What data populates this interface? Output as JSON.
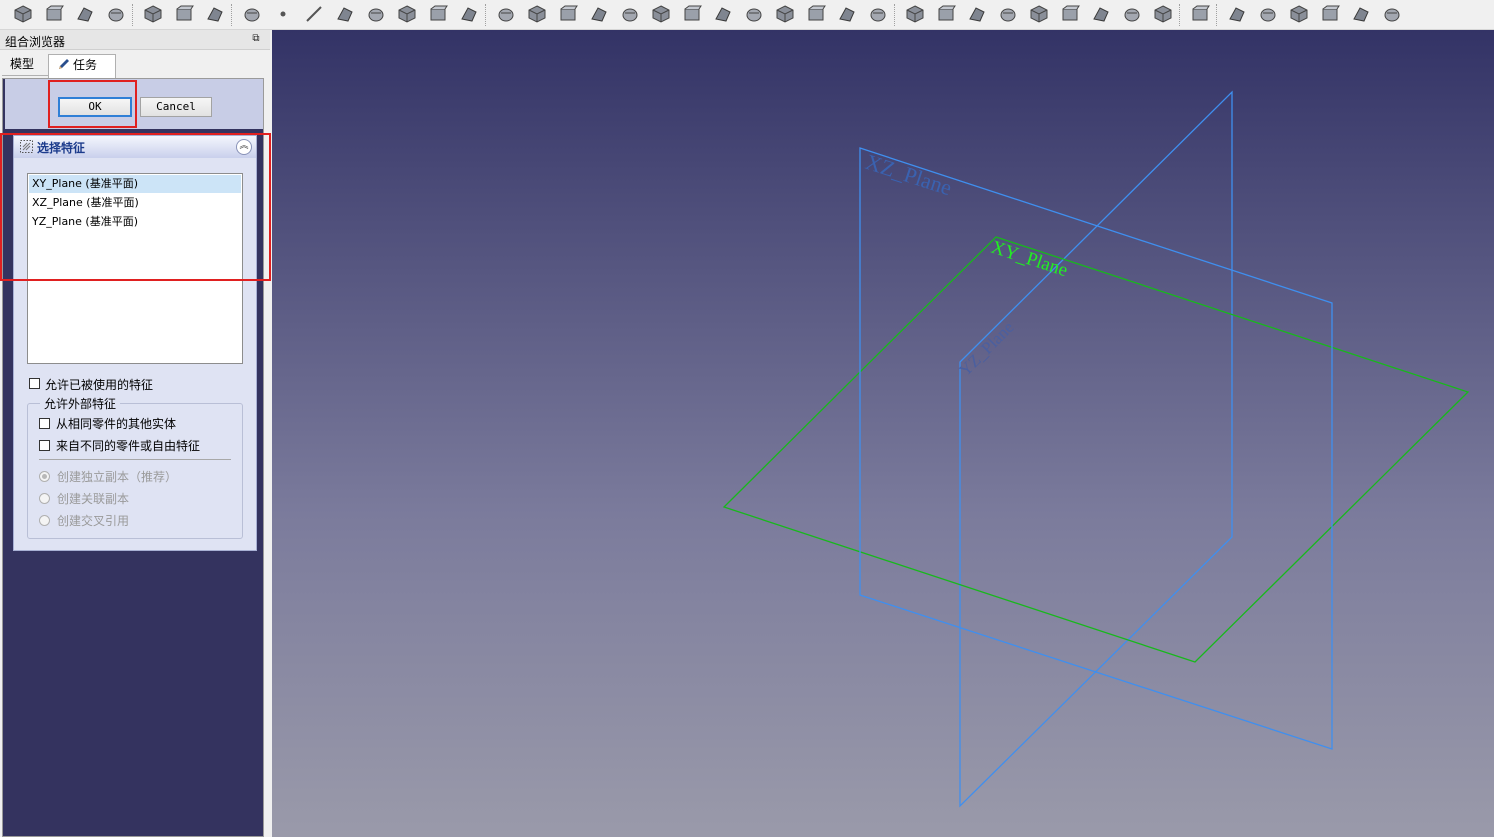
{
  "toolbar": {
    "icons": [
      "new-document-icon",
      "open-file-icon",
      "export-icon",
      "share-icon",
      "part-icon",
      "clone-icon",
      "import-icon",
      "box-icon",
      "point-icon",
      "line-icon",
      "plane-icon",
      "coordinate-system-icon",
      "shape-binder-icon",
      "subshape-binder-icon",
      "clone-object-icon",
      "pad-icon",
      "revolve-icon",
      "loft-icon",
      "pipe-icon",
      "helix-icon",
      "additive-primitive-icon",
      "pocket-icon",
      "hole-icon",
      "groove-icon",
      "subtractive-loft-icon",
      "subtractive-pipe-icon",
      "subtractive-helix-icon",
      "subtractive-primitive-icon",
      "mirror-icon",
      "linear-pattern-icon",
      "polar-pattern-icon",
      "multi-transform-icon",
      "fillet-icon",
      "chamfer-icon",
      "draft-icon",
      "thickness-icon",
      "boolean-icon",
      "measure-icon",
      "check-geometry-icon",
      "sprocket-icon",
      "involute-gear-icon",
      "shaft-design-icon",
      "hole-wizard-icon",
      "layer-icon"
    ]
  },
  "panel": {
    "title": "组合浏览器",
    "tabs": {
      "model": "模型",
      "task": "任务"
    }
  },
  "buttons": {
    "ok": "OK",
    "cancel": "Cancel"
  },
  "feature_select": {
    "title": "选择特征",
    "items": [
      "XY_Plane (基准平面)",
      "XZ_Plane (基准平面)",
      "YZ_Plane (基准平面)"
    ],
    "selected_index": 0,
    "allow_used_label": "允许已被使用的特征",
    "allow_used_checked": false,
    "external_group": {
      "title": "允许外部特征",
      "same_part_label": "从相同零件的其他实体",
      "same_part_checked": false,
      "other_part_label": "来自不同的零件或自由特征",
      "other_part_checked": false,
      "radio_independent": "创建独立副本（推荐）",
      "radio_dependent": "创建关联副本",
      "radio_cross_ref": "创建交叉引用",
      "radio_selected": "independent",
      "radios_enabled": false
    }
  },
  "viewport": {
    "planes": {
      "xz": "XZ_Plane",
      "xy": "XY_Plane",
      "yz": "YZ_Plane"
    },
    "colors": {
      "xz": "#3f8fef",
      "xy": "#18b81c",
      "yz": "#3f8fef",
      "xy_label": "#22ee22",
      "xz_label": "#3a62b0",
      "yz_label": "#4a5fa0"
    }
  },
  "highlight_color": "#e02020"
}
